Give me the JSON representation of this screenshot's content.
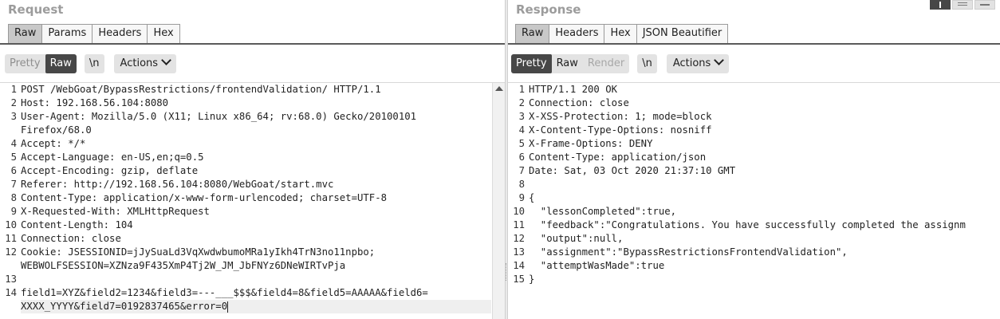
{
  "request": {
    "title": "Request",
    "tabs": [
      "Raw",
      "Params",
      "Headers",
      "Hex"
    ],
    "active_tab": "Raw",
    "toolbar": {
      "pretty": "Pretty",
      "raw": "Raw",
      "newline": "\\n",
      "actions": "Actions"
    },
    "line_numbers": [
      "1",
      "2",
      "3",
      "",
      "4",
      "5",
      "6",
      "7",
      "8",
      "9",
      "10",
      "11",
      "12",
      "",
      "13",
      "14",
      ""
    ],
    "lines": [
      "POST /WebGoat/BypassRestrictions/frontendValidation/ HTTP/1.1",
      "Host: 192.168.56.104:8080",
      "User-Agent: Mozilla/5.0 (X11; Linux x86_64; rv:68.0) Gecko/20100101",
      "Firefox/68.0",
      "Accept: */*",
      "Accept-Language: en-US,en;q=0.5",
      "Accept-Encoding: gzip, deflate",
      "Referer: http://192.168.56.104:8080/WebGoat/start.mvc",
      "Content-Type: application/x-www-form-urlencoded; charset=UTF-8",
      "X-Requested-With: XMLHttpRequest",
      "Content-Length: 104",
      "Connection: close",
      "Cookie: JSESSIONID=jJySuaLd3VqXwdwbumoMRa1yIkh4TrN3no11npbo;",
      "WEBWOLFSESSION=XZNza9F435XmP4Tj2W_JM_JbFNYz6DNeWIRTvPja",
      "",
      "field1=XYZ&field2=1234&field3=---___$$$&field4=8&field5=AAAAA&field6=",
      "XXXX_YYYY&field7=0192837465&error=0"
    ]
  },
  "response": {
    "title": "Response",
    "tabs": [
      "Raw",
      "Headers",
      "Hex",
      "JSON Beautifier"
    ],
    "active_tab": "Raw",
    "toolbar": {
      "pretty": "Pretty",
      "raw": "Raw",
      "render": "Render",
      "newline": "\\n",
      "actions": "Actions"
    },
    "line_numbers": [
      "1",
      "2",
      "3",
      "4",
      "5",
      "6",
      "7",
      "8",
      "9",
      "10",
      "11",
      "12",
      "13",
      "14",
      "15"
    ],
    "lines": [
      "HTTP/1.1 200 OK",
      "Connection: close",
      "X-XSS-Protection: 1; mode=block",
      "X-Content-Type-Options: nosniff",
      "X-Frame-Options: DENY",
      "Content-Type: application/json",
      "Date: Sat, 03 Oct 2020 21:37:10 GMT",
      "",
      "{",
      "  \"lessonCompleted\":true,",
      "  \"feedback\":\"Congratulations. You have successfully completed the assignm",
      "  \"output\":null,",
      "  \"assignment\":\"BypassRestrictionsFrontendValidation\",",
      "  \"attemptWasMade\":true",
      "}"
    ]
  }
}
